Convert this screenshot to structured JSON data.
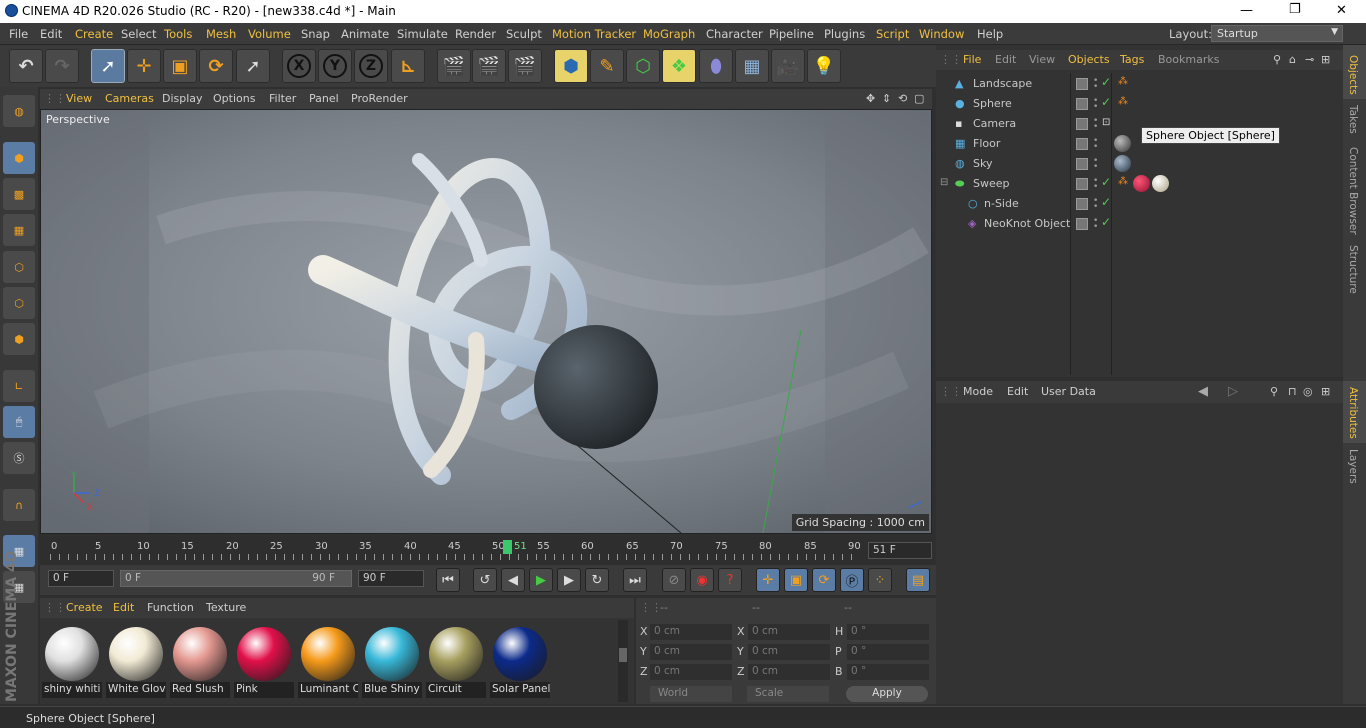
{
  "window": {
    "title": "CINEMA 4D R20.026 Studio (RC - R20) - [new338.c4d *] - Main",
    "min": "—",
    "max": "❐",
    "close": "✕"
  },
  "menubar": {
    "items": [
      "File",
      "Edit",
      "Create",
      "Select",
      "Tools",
      "Mesh",
      "Volume",
      "Snap",
      "Animate",
      "Simulate",
      "Render",
      "Sculpt",
      "Motion Tracker",
      "MoGraph",
      "Character",
      "Pipeline",
      "Plugins",
      "Script",
      "Window",
      "Help"
    ],
    "layout_label": "Layout:",
    "layout_value": "Startup"
  },
  "toolbar": {
    "x_label": "X",
    "y_label": "Y",
    "z_label": "Z"
  },
  "viewport": {
    "menu": [
      "View",
      "Cameras",
      "Display",
      "Options",
      "Filter",
      "Panel",
      "ProRender"
    ],
    "label": "Perspective",
    "grid_spacing": "Grid Spacing : 1000 cm",
    "axis_y": "Y",
    "axis_z": "Z",
    "axis_x": "X"
  },
  "timeline": {
    "ticks": [
      "0",
      "5",
      "10",
      "15",
      "20",
      "25",
      "30",
      "35",
      "40",
      "45",
      "50",
      "51",
      "55",
      "60",
      "65",
      "70",
      "75",
      "80",
      "85",
      "90"
    ],
    "current_frame": "51 F",
    "start_field": "0 F",
    "range_start": "0 F",
    "range_end": "90 F",
    "end_field": "90 F"
  },
  "materials": {
    "menu": [
      "Create",
      "Edit",
      "Function",
      "Texture"
    ],
    "items": [
      {
        "name": "shiny whiti",
        "color": "#e0e0e0"
      },
      {
        "name": "White Glov",
        "color": "#f1ead4"
      },
      {
        "name": "Red Slush",
        "color": "#e49890"
      },
      {
        "name": "Pink",
        "color": "#e1104a"
      },
      {
        "name": "Luminant C",
        "color": "#f59a1a"
      },
      {
        "name": "Blue Shiny",
        "color": "#38b8d8"
      },
      {
        "name": "Circuit",
        "color": "#a8a060"
      },
      {
        "name": "Solar Panel",
        "color": "#0c2a8a"
      }
    ]
  },
  "coordinates": {
    "headers": [
      "--",
      "--",
      "--"
    ],
    "rows": [
      {
        "a": "X",
        "av": "0 cm",
        "b": "X",
        "bv": "0 cm",
        "c": "H",
        "cv": "0 °"
      },
      {
        "a": "Y",
        "av": "0 cm",
        "b": "Y",
        "bv": "0 cm",
        "c": "P",
        "cv": "0 °"
      },
      {
        "a": "Z",
        "av": "0 cm",
        "b": "Z",
        "bv": "0 cm",
        "c": "B",
        "cv": "0 °"
      }
    ],
    "world": "World",
    "scale": "Scale",
    "apply": "Apply"
  },
  "objects": {
    "menu": [
      "File",
      "Edit",
      "View",
      "Objects",
      "Tags",
      "Bookmarks"
    ],
    "rows": [
      {
        "name": "Landscape"
      },
      {
        "name": "Sphere"
      },
      {
        "name": "Camera"
      },
      {
        "name": "Floor"
      },
      {
        "name": "Sky"
      },
      {
        "name": "Sweep"
      },
      {
        "name": "n-Side"
      },
      {
        "name": "NeoKnot Object"
      }
    ],
    "tooltip": "Sphere Object [Sphere]"
  },
  "attributes": {
    "menu": [
      "Mode",
      "Edit",
      "User Data"
    ]
  },
  "side_tabs": [
    "Objects",
    "Takes",
    "Content Browser",
    "Structure",
    "Attributes",
    "Layers"
  ],
  "status": "Sphere Object [Sphere]",
  "brand": "MAXON CINEMA 4D"
}
